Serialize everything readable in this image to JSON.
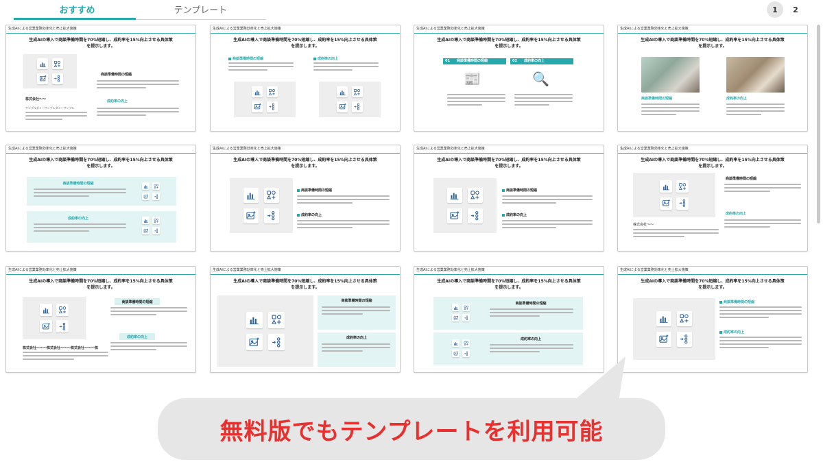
{
  "tabs": [
    {
      "label": "おすすめ",
      "active": true
    },
    {
      "label": "テンプレート",
      "active": false
    }
  ],
  "pagination": {
    "pages": [
      "1",
      "2"
    ],
    "current": "1"
  },
  "slide": {
    "header": "生成AIによる営業業務効率化と売上拡大施策",
    "title_line1": "生成AIの導入で商談準備時間を70%短縮し、成約率を15%向上させる具体策",
    "title_line2": "を提示します。",
    "label_a": "商談準備時間の短縮",
    "label_b": "成約率の向上",
    "num_a": "01",
    "num_b": "02",
    "company": "株式会社〜〜",
    "company_long": "株式会社〜〜〜株式会社〜〜〜株式会社〜〜〜株",
    "filler": "サンプルダミーサンプルダミーサンプル"
  },
  "callout": {
    "text": "無料版でもテンプレートを利用可能"
  },
  "colors": {
    "accent": "#25a9ad",
    "callout_text": "#e8302f",
    "callout_bg": "#e6e6e6"
  },
  "icon_names": [
    "bar-chart-icon",
    "shapes-icon",
    "image-icon",
    "flow-icon"
  ]
}
